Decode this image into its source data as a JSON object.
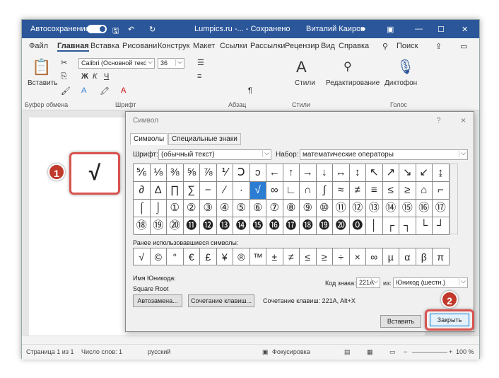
{
  "titlebar": {
    "autosave": "Автосохранение",
    "doc": "Lumpics.ru -...  -  Сохранено",
    "user": "Виталий Каиров"
  },
  "menu": [
    "Файл",
    "Главная",
    "Вставка",
    "Рисовани",
    "Конструк",
    "Макет",
    "Ссылки",
    "Рассылки",
    "Рецензир",
    "Вид",
    "Справка",
    "Поиск"
  ],
  "ribbon": {
    "paste": "Вставить",
    "font": "Calibri (Основной текс",
    "size": "36",
    "styles": "Стили",
    "editing": "Редактирование",
    "dictation": "Диктофон",
    "groups": [
      "Буфер обмена",
      "Шрифт",
      "Абзац",
      "Стили",
      "Голос"
    ]
  },
  "doc": {
    "symbol": "√"
  },
  "dialog": {
    "title": "Символ",
    "help": "?",
    "close": "×",
    "tabs": [
      "Символы",
      "Специальные знаки"
    ],
    "font_label": "Шрифт:",
    "font_value": "(обычный текст)",
    "subset_label": "Набор:",
    "subset_value": "математические операторы",
    "grid": [
      [
        "⅚",
        "⅛",
        "⅜",
        "⅝",
        "⅞",
        "⅟",
        "Ↄ",
        "ↄ",
        "←",
        "↑",
        "→",
        "↓",
        "↔",
        "↕",
        "↖",
        "↗",
        "↘",
        "↙",
        "↨"
      ],
      [
        "∂",
        "∆",
        "∏",
        "∑",
        "−",
        "∕",
        "∙",
        "√",
        "∞",
        "∟",
        "∩",
        "∫",
        "≈",
        "≠",
        "≡",
        "≤",
        "≥",
        "⌂",
        "⌐"
      ],
      [
        "⌠",
        "⌡",
        "①",
        "②",
        "③",
        "④",
        "⑤",
        "⑥",
        "⑦",
        "⑧",
        "⑨",
        "⑩",
        "⑪",
        "⑫",
        "⑬",
        "⑭",
        "⑮",
        "⑯",
        "⑰"
      ],
      [
        "⑱",
        "⑲",
        "⑳",
        "⓫",
        "⓬",
        "⓭",
        "⓮",
        "⓯",
        "⓰",
        "⓱",
        "⓲",
        "⓳",
        "⓴",
        "⓿",
        "│",
        "┌",
        "┐",
        "└",
        "┘"
      ]
    ],
    "recent_label": "Ранее использовавшиеся символы:",
    "recent": [
      "√",
      "©",
      "°",
      "€",
      "£",
      "¥",
      "®",
      "™",
      "±",
      "≠",
      "≤",
      "≥",
      "÷",
      "×",
      "∞",
      "µ",
      "α",
      "β",
      "π"
    ],
    "unicode_label": "Имя Юникода:",
    "unicode_name": "Square Root",
    "code_label": "Код знака:",
    "code_value": "221A",
    "from_label": "из:",
    "from_value": "Юникод (шестн.)",
    "autocorrect": "Автозамена...",
    "shortcut_btn": "Сочетание клавиш...",
    "shortcut_text": "Сочетание клавиш: 221A, Alt+X",
    "insert": "Вставить",
    "close_btn": "Закрыть"
  },
  "status": {
    "page": "Страница 1 из 1",
    "words": "Число слов: 1",
    "lang": "русский",
    "focus": "Фокусировка",
    "zoom": "100 %"
  },
  "callouts": [
    "1",
    "2"
  ]
}
